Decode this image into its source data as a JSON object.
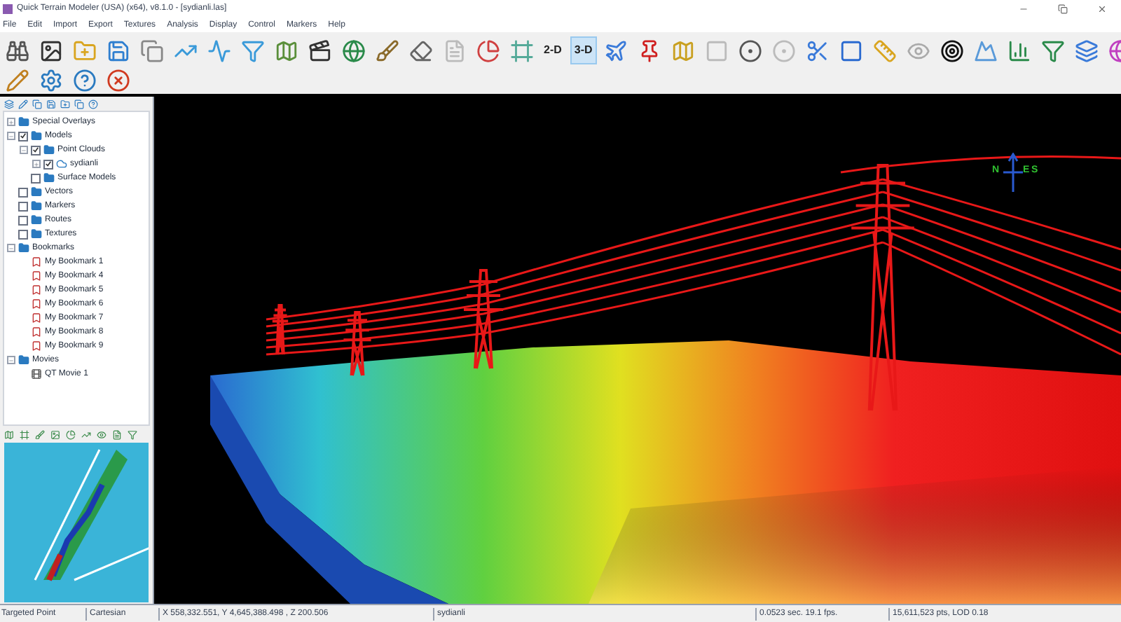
{
  "window": {
    "title": "Quick Terrain Modeler (USA) (x64), v8.1.0 - [sydianli.las]"
  },
  "menu": [
    "File",
    "Edit",
    "Import",
    "Export",
    "Textures",
    "Analysis",
    "Display",
    "Control",
    "Markers",
    "Help"
  ],
  "toolbar": [
    {
      "label": "2-D",
      "selected": false
    },
    {
      "label": "3-D",
      "selected": true
    }
  ],
  "tree": [
    {
      "label": "Special Overlays",
      "kind": "folder",
      "expanded": false
    },
    {
      "label": "Models",
      "kind": "folder",
      "expanded": true,
      "checked": true,
      "children": [
        {
          "label": "Point Clouds",
          "kind": "folder",
          "expanded": true,
          "checked": true,
          "children": [
            {
              "label": "sydianli",
              "kind": "cloud",
              "expanded": false,
              "checked": true
            }
          ]
        },
        {
          "label": "Surface Models",
          "kind": "folder",
          "checked": false
        }
      ]
    },
    {
      "label": "Vectors",
      "kind": "folder",
      "checked": false
    },
    {
      "label": "Markers",
      "kind": "folder",
      "checked": false
    },
    {
      "label": "Routes",
      "kind": "folder",
      "checked": false
    },
    {
      "label": "Textures",
      "kind": "folder",
      "checked": false
    },
    {
      "label": "Bookmarks",
      "kind": "folder",
      "expanded": true,
      "children": [
        {
          "label": "My Bookmark 1",
          "kind": "bookmark"
        },
        {
          "label": "My Bookmark 4",
          "kind": "bookmark"
        },
        {
          "label": "My Bookmark 5",
          "kind": "bookmark"
        },
        {
          "label": "My Bookmark 6",
          "kind": "bookmark"
        },
        {
          "label": "My Bookmark 7",
          "kind": "bookmark"
        },
        {
          "label": "My Bookmark 8",
          "kind": "bookmark"
        },
        {
          "label": "My Bookmark 9",
          "kind": "bookmark"
        }
      ]
    },
    {
      "label": "Movies",
      "kind": "folder",
      "expanded": true,
      "children": [
        {
          "label": "QT Movie 1",
          "kind": "movie"
        }
      ]
    }
  ],
  "compass": {
    "north": "N",
    "east": "E",
    "south": "S"
  },
  "status_bar": {
    "mode": "Targeted Point",
    "system": "Cartesian",
    "coordinates": "X 558,332.551, Y 4,645,388.498 , Z 200.506",
    "file": "sydianli",
    "timing": "0.0523 sec. 19.1 fps.",
    "points": "15,611,523 pts, LOD 0.18"
  }
}
